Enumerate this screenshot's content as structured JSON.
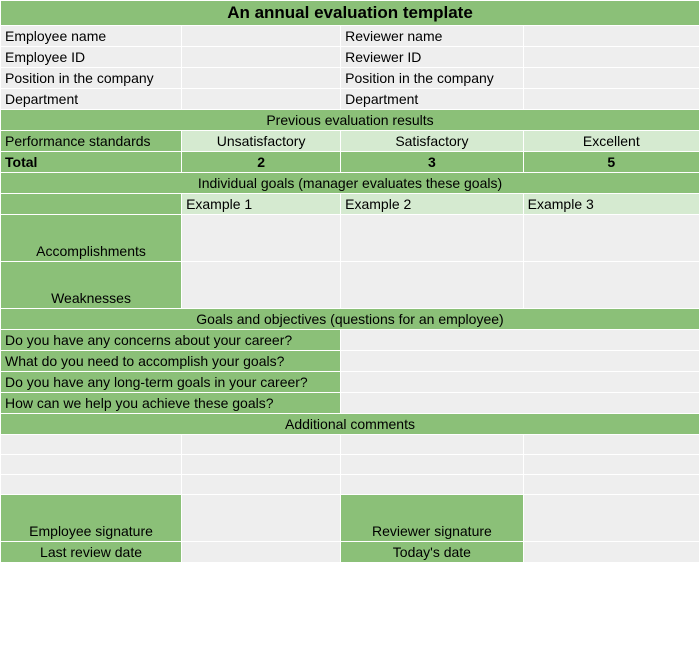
{
  "title": "An annual evaluation template",
  "info": {
    "emp_name": "Employee name",
    "emp_id": "Employee ID",
    "emp_pos": "Position in the company",
    "emp_dept": "Department",
    "rev_name": "Reviewer name",
    "rev_id": "Reviewer ID",
    "rev_pos": "Position in the company",
    "rev_dept": "Department"
  },
  "prev": {
    "heading": "Previous evaluation results",
    "stds_label": "Performance standards",
    "levels": [
      "Unsatisfactory",
      "Satisfactory",
      "Excellent"
    ],
    "total_label": "Total",
    "totals": [
      "2",
      "3",
      "5"
    ]
  },
  "goals": {
    "heading": "Individual goals (manager evaluates these goals)",
    "examples": [
      "Example 1",
      "Example 2",
      "Example 3"
    ],
    "rows": [
      "Accomplishments",
      "Weaknesses"
    ]
  },
  "questions": {
    "heading": "Goals and objectives (questions for an employee)",
    "items": [
      "Do you have any concerns about your career?",
      "What do you need to accomplish your goals?",
      "Do you have any long-term goals in your career?",
      "How can we help you achieve these goals?"
    ]
  },
  "comments_heading": "Additional comments",
  "sign": {
    "emp": "Employee signature",
    "rev": "Reviewer signature",
    "last": "Last review date",
    "today": "Today's date"
  }
}
